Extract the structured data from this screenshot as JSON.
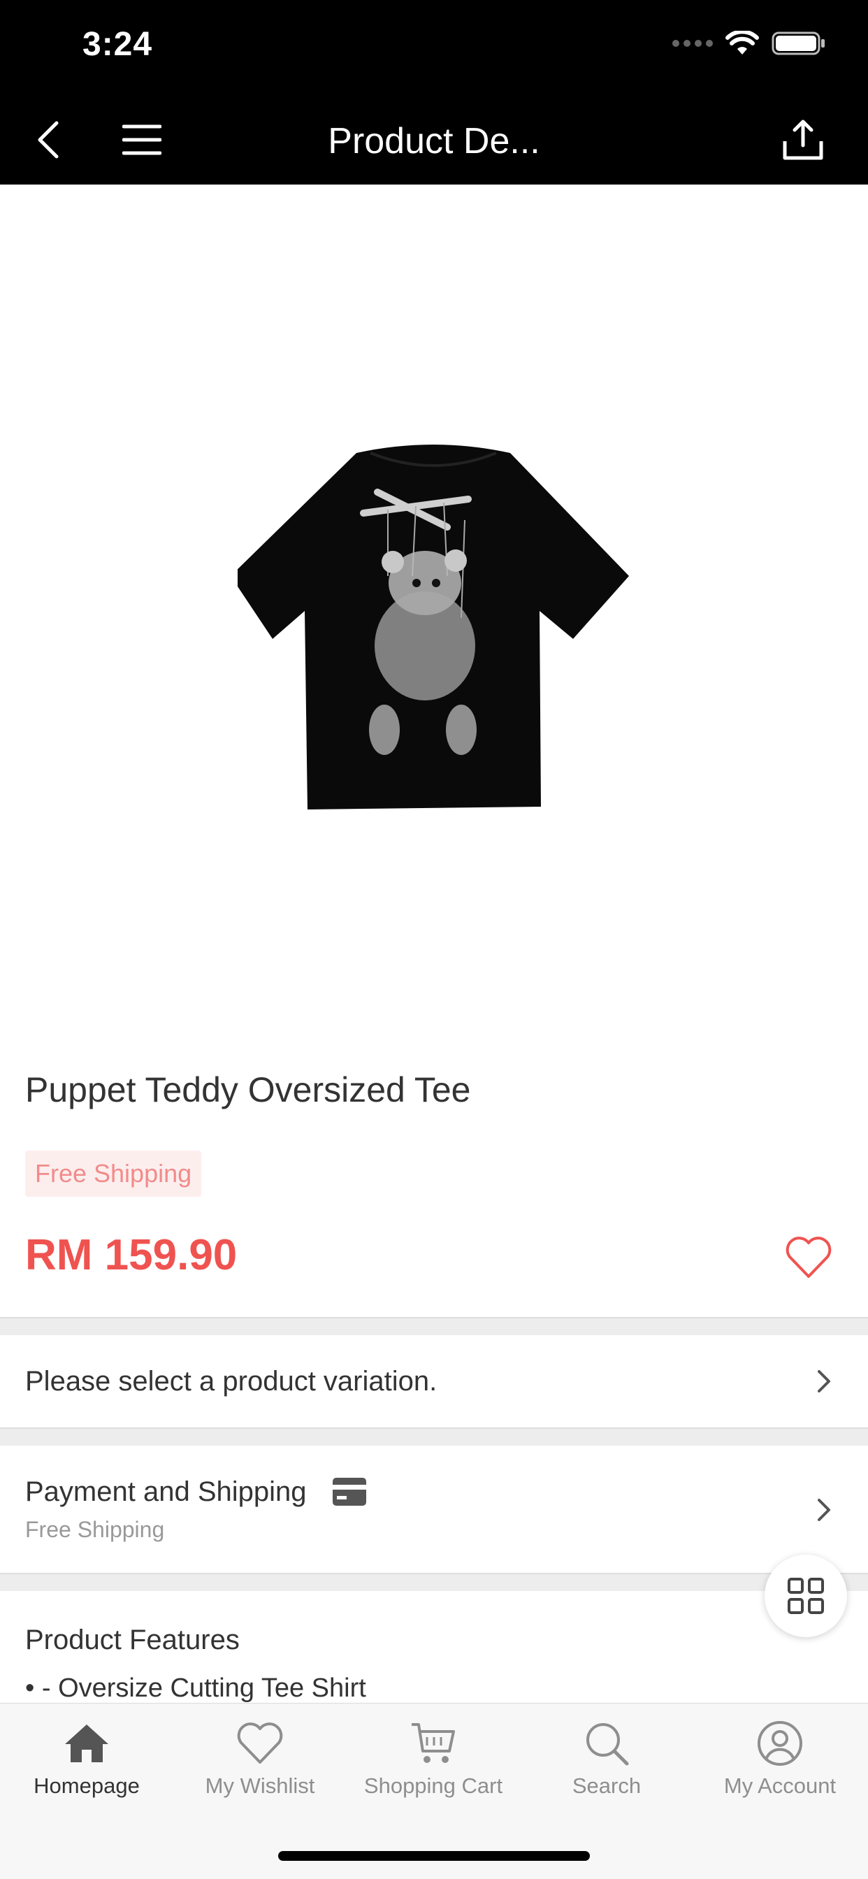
{
  "status_bar": {
    "time": "3:24"
  },
  "nav": {
    "title": "Product De..."
  },
  "product": {
    "name": "Puppet Teddy Oversized Tee",
    "shipping_badge": "Free Shipping",
    "price": "RM 159.90"
  },
  "variation": {
    "label": "Please select a product variation."
  },
  "payment": {
    "label": "Payment and Shipping",
    "sub": "Free Shipping"
  },
  "features": {
    "title": "Product Features",
    "items": [
      "• - Oversize Cutting Tee Shirt"
    ]
  },
  "tabs": [
    {
      "label": "Homepage",
      "icon": "home-icon",
      "active": true
    },
    {
      "label": "My Wishlist",
      "icon": "heart-icon",
      "active": false
    },
    {
      "label": "Shopping Cart",
      "icon": "cart-icon",
      "active": false
    },
    {
      "label": "Search",
      "icon": "search-icon",
      "active": false
    },
    {
      "label": "My Account",
      "icon": "account-icon",
      "active": false
    }
  ],
  "colors": {
    "price": "#ef5350",
    "badge_bg": "#fdeeee",
    "badge_text": "#f28b8b",
    "topbar": "#000000"
  }
}
